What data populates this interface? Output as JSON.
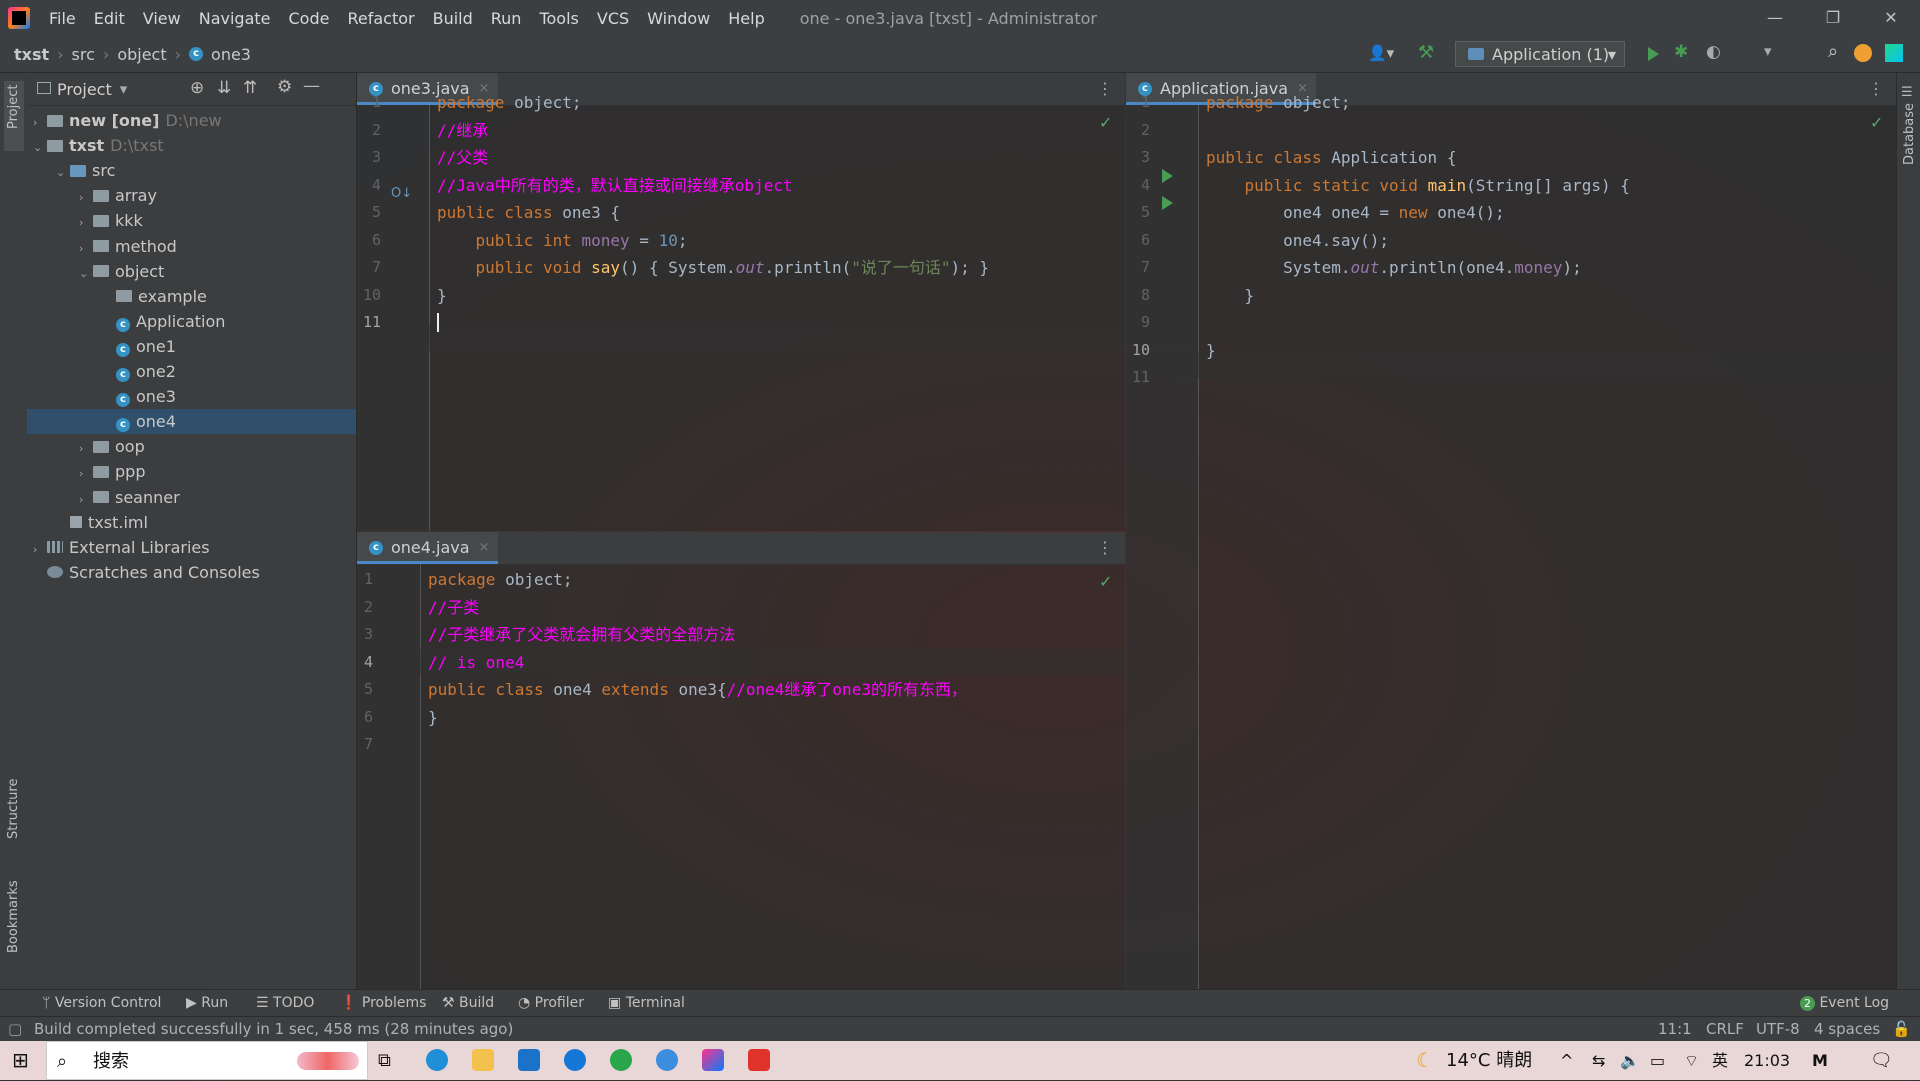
{
  "titlebar": {
    "menu": [
      "File",
      "Edit",
      "View",
      "Navigate",
      "Code",
      "Refactor",
      "Build",
      "Run",
      "Tools",
      "VCS",
      "Window",
      "Help"
    ],
    "window_title": "one - one3.java [txst] - Administrator",
    "minimize": "—",
    "restore": "❐",
    "close": "✕"
  },
  "navbar": {
    "breadcrumb": [
      "txst",
      "src",
      "object",
      "one3"
    ],
    "run_config": "Application (1)"
  },
  "left_stripe": {
    "project": "Project",
    "structure": "Structure",
    "bookmarks": "Bookmarks"
  },
  "right_stripe": {
    "database": "Database"
  },
  "project_panel": {
    "title": "Project",
    "tree": [
      {
        "label": "new [one]",
        "path": "D:\\new",
        "level": 0,
        "arrow": "›",
        "kind": "module"
      },
      {
        "label": "txst",
        "path": "D:\\txst",
        "level": 0,
        "arrow": "⌄",
        "kind": "module"
      },
      {
        "label": "src",
        "level": 1,
        "arrow": "⌄",
        "kind": "src"
      },
      {
        "label": "array",
        "level": 2,
        "arrow": "›",
        "kind": "folder"
      },
      {
        "label": "kkk",
        "level": 2,
        "arrow": "›",
        "kind": "folder"
      },
      {
        "label": "method",
        "level": 2,
        "arrow": "›",
        "kind": "folder"
      },
      {
        "label": "object",
        "level": 2,
        "arrow": "⌄",
        "kind": "folder"
      },
      {
        "label": "example",
        "level": 3,
        "arrow": "",
        "kind": "folder"
      },
      {
        "label": "Application",
        "level": 3,
        "arrow": "",
        "kind": "class"
      },
      {
        "label": "one1",
        "level": 3,
        "arrow": "",
        "kind": "class"
      },
      {
        "label": "one2",
        "level": 3,
        "arrow": "",
        "kind": "class"
      },
      {
        "label": "one3",
        "level": 3,
        "arrow": "",
        "kind": "class"
      },
      {
        "label": "one4",
        "level": 3,
        "arrow": "",
        "kind": "class",
        "selected": true
      },
      {
        "label": "oop",
        "level": 2,
        "arrow": "›",
        "kind": "folder"
      },
      {
        "label": "ppp",
        "level": 2,
        "arrow": "›",
        "kind": "folder"
      },
      {
        "label": "seanner",
        "level": 2,
        "arrow": "›",
        "kind": "folder"
      },
      {
        "label": "txst.iml",
        "level": 1,
        "arrow": "",
        "kind": "file"
      },
      {
        "label": "External Libraries",
        "level": 0,
        "arrow": "›",
        "kind": "lib"
      },
      {
        "label": "Scratches and Consoles",
        "level": 0,
        "arrow": "",
        "kind": "scratch"
      }
    ]
  },
  "editors": {
    "one3": {
      "tab": "one3.java",
      "tab_close": "×",
      "line_numbers": [
        "1",
        "2",
        "3",
        "4",
        "5",
        "6",
        "7",
        "10",
        "11"
      ],
      "current_line": "11"
    },
    "one4": {
      "tab": "one4.java",
      "tab_close": "×",
      "line_numbers": [
        "1",
        "2",
        "3",
        "4",
        "5",
        "6",
        "7"
      ],
      "current_line": "4"
    },
    "application": {
      "tab": "Application.java",
      "tab_close": "×",
      "line_numbers": [
        "1",
        "2",
        "3",
        "4",
        "5",
        "6",
        "7",
        "8",
        "9",
        "10",
        "11"
      ],
      "current_line": "10"
    }
  },
  "toolwindows": {
    "version_control": "Version Control",
    "run": "Run",
    "todo": "TODO",
    "problems": "Problems",
    "build": "Build",
    "profiler": "Profiler",
    "terminal": "Terminal",
    "event_log": "Event Log",
    "event_log_count": "2"
  },
  "statusbar": {
    "message": "Build completed successfully in 1 sec, 458 ms (28 minutes ago)",
    "position": "11:1",
    "line_sep": "CRLF",
    "encoding": "UTF-8",
    "indent": "4 spaces"
  },
  "taskbar": {
    "search": "搜索",
    "weather": "14°C 晴朗",
    "ime": "英",
    "time": "21:03"
  },
  "colors": {
    "keyword": "#cc7832",
    "comment": "#ff00ff",
    "number": "#6897bb",
    "string": "#6a8759",
    "method": "#ffc66d",
    "field": "#9876aa",
    "selection": "#2f4f6b"
  }
}
